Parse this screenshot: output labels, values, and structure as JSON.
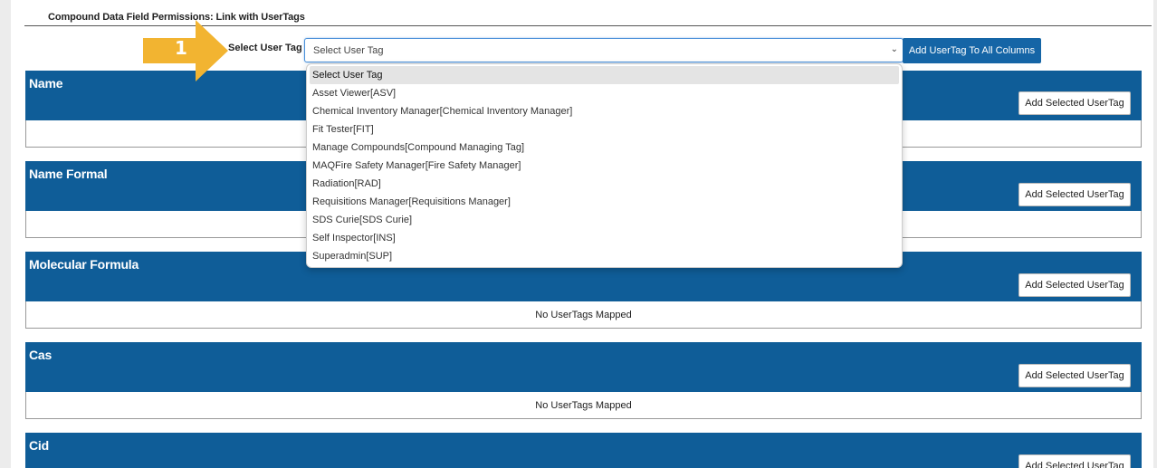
{
  "page": {
    "title": "Compound Data Field Permissions: Link with UserTags"
  },
  "callout": {
    "number": "1",
    "color": "#f2b431"
  },
  "selector": {
    "label": "Select User Tag",
    "value": "Select User Tag",
    "add_all_label": "Add UserTag To All Columns"
  },
  "dropdown": {
    "options": [
      "Select User Tag",
      "Asset Viewer[ASV]",
      "Chemical Inventory Manager[Chemical Inventory Manager]",
      "Fit Tester[FIT]",
      "Manage Compounds[Compound Managing Tag]",
      "MAQFire Safety Manager[Fire Safety Manager]",
      "Radiation[RAD]",
      "Requisitions Manager[Requisitions Manager]",
      "SDS Curie[SDS Curie]",
      "Self Inspector[INS]",
      "Superadmin[SUP]"
    ]
  },
  "sections": [
    {
      "title": "Name",
      "button_label": "Add Selected UserTag",
      "body_text": ""
    },
    {
      "title": "Name Formal",
      "button_label": "Add Selected UserTag",
      "body_text": ""
    },
    {
      "title": "Molecular Formula",
      "button_label": "Add Selected UserTag",
      "body_text": "No UserTags Mapped"
    },
    {
      "title": "Cas",
      "button_label": "Add Selected UserTag",
      "body_text": "No UserTags Mapped"
    },
    {
      "title": "Cid",
      "button_label": "Add Selected UserTag",
      "body_text": ""
    }
  ],
  "colors": {
    "section_header": "#0f5d98",
    "primary_button": "#1565a6",
    "callout": "#f2b431"
  }
}
